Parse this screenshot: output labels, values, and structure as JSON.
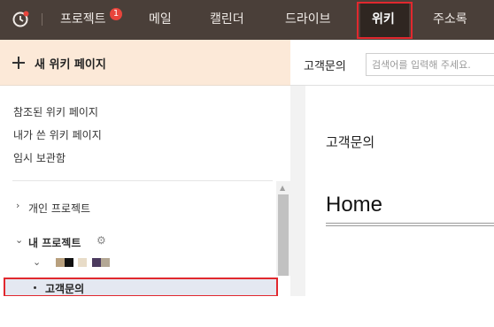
{
  "nav": {
    "items": [
      {
        "label": "프로젝트",
        "badge": "1"
      },
      {
        "label": "메일"
      },
      {
        "label": "캘린더"
      },
      {
        "label": "드라이브"
      },
      {
        "label": "위키"
      },
      {
        "label": "주소록"
      }
    ],
    "active": "위키",
    "clock_icon": "clock-icon",
    "colors": {
      "bar": "#4a3f39",
      "active_bg": "#2f2621",
      "highlight": "#e1282e",
      "badge": "#e8453c"
    }
  },
  "sidebar": {
    "new_wiki_label": "새 위키 페이지",
    "links": [
      "참조된 위키 페이지",
      "내가 쓴 위키 페이지",
      "임시 보관함"
    ],
    "tree": {
      "personal_project": "개인 프로젝트",
      "my_projects": "내 프로젝트",
      "selected_page": "고객문의"
    },
    "swatch_colors": [
      "#b8a07e",
      "#111111",
      "#e8dcc8",
      "#4b3a5e",
      "#b3a794"
    ],
    "colors": {
      "new_wiki_bg": "#fce9d8",
      "selected_bg": "#e4e8f1"
    }
  },
  "main": {
    "header_title": "고객문의",
    "search": {
      "placeholder": "검색어를 입력해 주세요.",
      "value": ""
    },
    "doc_subtitle": "고객문의",
    "doc_title": "Home"
  }
}
